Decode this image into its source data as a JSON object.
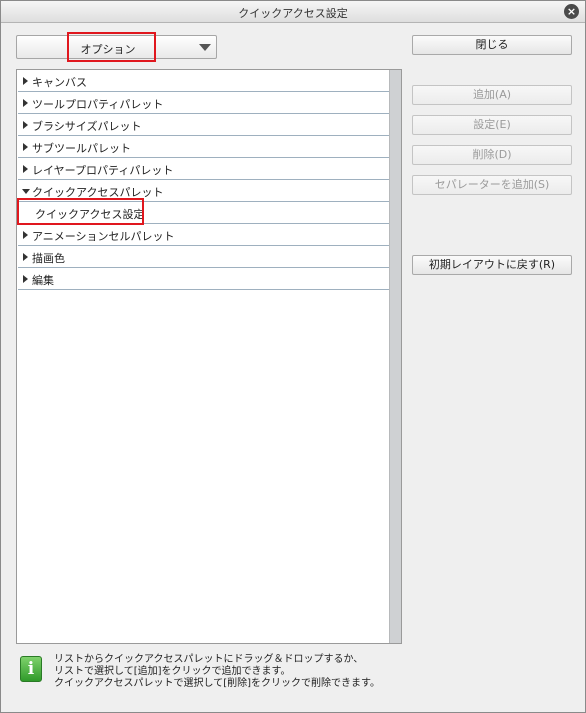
{
  "window": {
    "title": "クイックアクセス設定",
    "close_label": "×"
  },
  "combo": {
    "value": "オプション"
  },
  "tree": {
    "items": [
      {
        "label": "キャンバス",
        "expanded": false
      },
      {
        "label": "ツールプロパティパレット",
        "expanded": false
      },
      {
        "label": "ブラシサイズパレット",
        "expanded": false
      },
      {
        "label": "サブツールパレット",
        "expanded": false
      },
      {
        "label": "レイヤープロパティパレット",
        "expanded": false
      },
      {
        "label": "クイックアクセスパレット",
        "expanded": true
      },
      {
        "label": "クイックアクセス設定",
        "child": true
      },
      {
        "label": "アニメーションセルパレット",
        "expanded": false
      },
      {
        "label": "描画色",
        "expanded": false
      },
      {
        "label": "編集",
        "expanded": false
      }
    ]
  },
  "buttons": {
    "close": "閉じる",
    "add": "追加(A)",
    "settings": "設定(E)",
    "delete": "削除(D)",
    "add_separator": "セパレーターを追加(S)",
    "reset_layout": "初期レイアウトに戻す(R)"
  },
  "info": {
    "icon": "i",
    "lines": [
      "リストからクイックアクセスパレットにドラッグ＆ドロップするか、",
      "リストで選択して[追加]をクリックで追加できます。",
      "クイックアクセスパレットで選択して[削除]をクリックで削除できます。"
    ]
  }
}
